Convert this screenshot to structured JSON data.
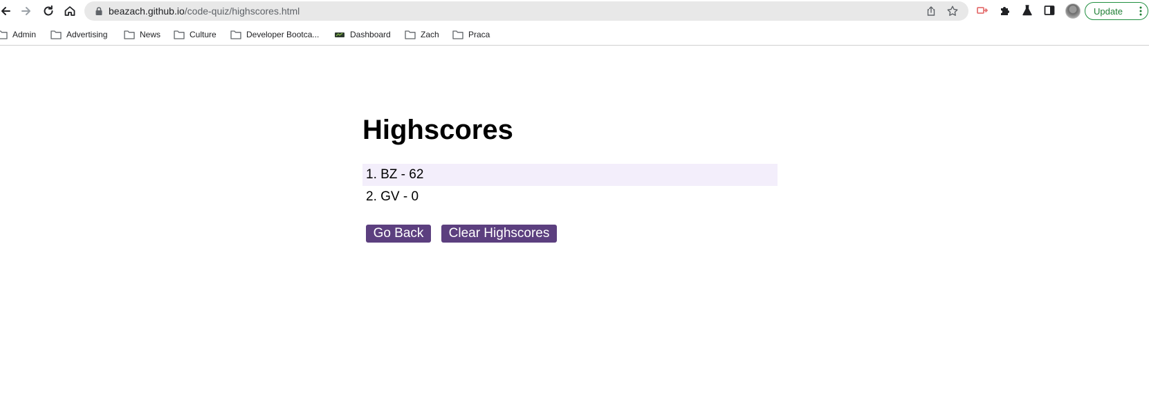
{
  "browser": {
    "url_host": "beazach.github.io",
    "url_path": "/code-quiz/highscores.html",
    "update_label": "Update"
  },
  "bookmarks": [
    {
      "label": "Admin",
      "icon": "folder-icon"
    },
    {
      "label": "Advertising",
      "icon": "folder-icon"
    },
    {
      "label": "News",
      "icon": "folder-icon"
    },
    {
      "label": "Culture",
      "icon": "folder-icon"
    },
    {
      "label": "Developer Bootca...",
      "icon": "folder-icon"
    },
    {
      "label": "Dashboard",
      "icon": "dashboard-favicon-icon"
    },
    {
      "label": "Zach",
      "icon": "folder-icon"
    },
    {
      "label": "Praca",
      "icon": "folder-icon"
    }
  ],
  "page": {
    "title": "Highscores",
    "scores": [
      {
        "text": "1. BZ - 62"
      },
      {
        "text": "2. GV - 0"
      }
    ],
    "go_back_label": "Go Back",
    "clear_label": "Clear Highscores"
  },
  "colors": {
    "button_bg": "#5c3f7f",
    "row_highlight": "#f3eefb",
    "update_border": "#1e8e3e"
  }
}
